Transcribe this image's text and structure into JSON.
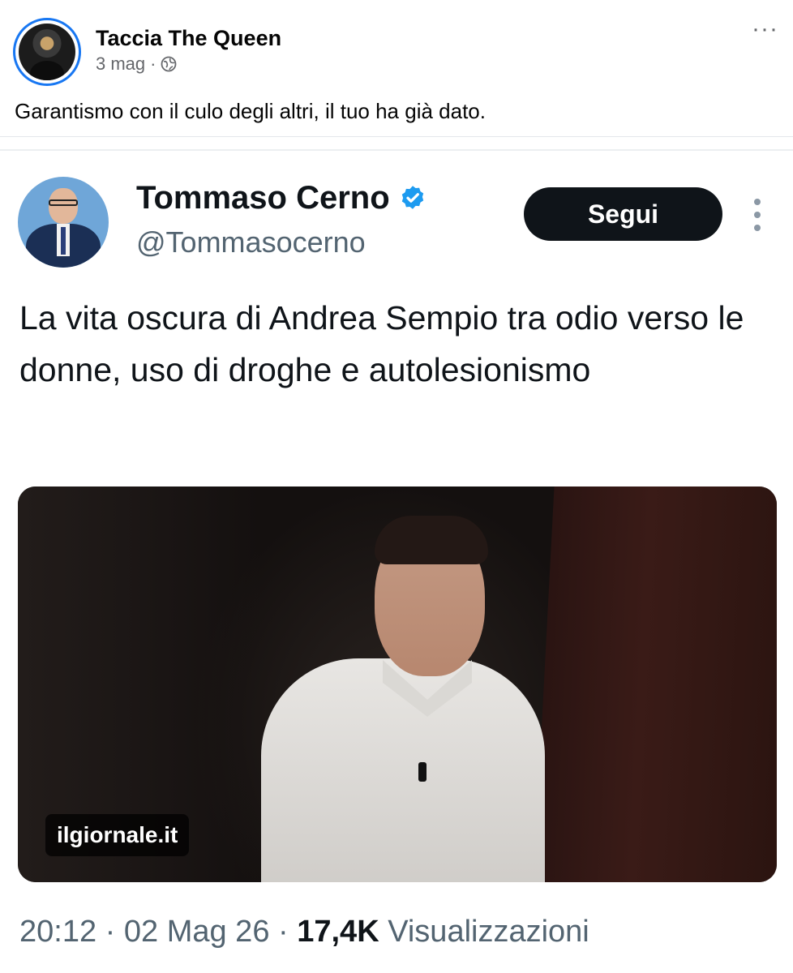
{
  "facebook_post": {
    "author_name": "Taccia The Queen",
    "date": "3 mag",
    "separator": "·",
    "text": "Garantismo con il culo degli altri, il tuo ha già dato.",
    "more_icon": "···"
  },
  "tweet": {
    "author_name": "Tommaso Cerno",
    "handle": "@Tommasocerno",
    "follow_label": "Segui",
    "text": "La vita oscura di Andrea Sempio tra odio verso le donne, uso di droghe e autolesionismo",
    "media_badge": "ilgiornale.it",
    "time": "20:12",
    "date": "02 Mag 26",
    "separator": " · ",
    "views_count": "17,4K",
    "views_label": "Visualizzazioni",
    "verified_color": "#1d9bf0"
  },
  "colors": {
    "facebook_blue": "#1877f2",
    "follow_button_bg": "#0f1419",
    "secondary_text": "#536471"
  },
  "icons": [
    "globe-icon",
    "more-options-icon",
    "verified-badge-icon",
    "tweet-more-icon"
  ]
}
